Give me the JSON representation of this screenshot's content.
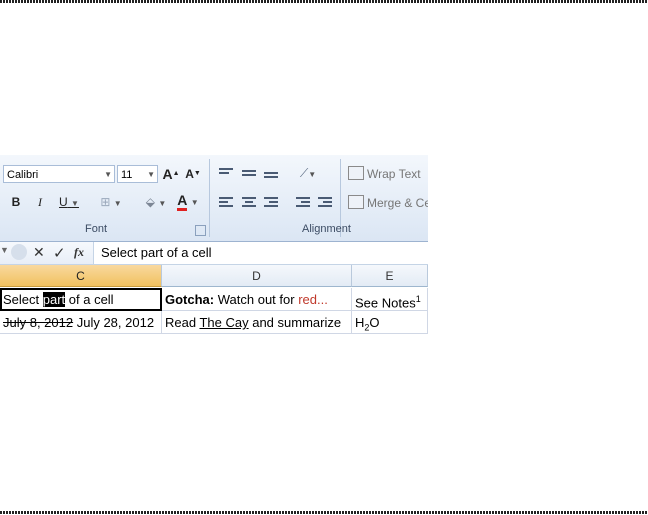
{
  "ribbon": {
    "font_name": "Calibri",
    "font_size": "11",
    "bold": "B",
    "italic": "I",
    "underline": "U",
    "increase_font": "A",
    "decrease_font": "A",
    "font_color_glyph": "A",
    "font_group_label": "Font",
    "alignment_group_label": "Alignment",
    "wrap_text": "Wrap Text",
    "merge_center": "Merge & Ce",
    "colors": {
      "font_color_bar": "#e02020",
      "ribbon_bg": "#dbe6f4"
    }
  },
  "formula_bar": {
    "cancel_glyph": "✕",
    "enter_glyph": "✓",
    "fx_label": "fx",
    "content": "Select part of a cell"
  },
  "grid": {
    "columns": [
      "C",
      "D",
      "E"
    ],
    "selected_column": "C",
    "row1": {
      "c_before": "Select ",
      "c_highlight": "part",
      "c_after": " of a cell",
      "d_bold": "Gotcha:",
      "d_normal": " Watch out for ",
      "d_red": "red...",
      "e_text": "See Notes",
      "e_sup": "1"
    },
    "row2": {
      "c_strike": "July 8, 2012",
      "c_normal": " July 28, 2012",
      "d_before": "Read ",
      "d_underline": "The Cay",
      "d_after": " and summarize",
      "e_base": "H",
      "e_sub": "2",
      "e_after": "O"
    }
  }
}
